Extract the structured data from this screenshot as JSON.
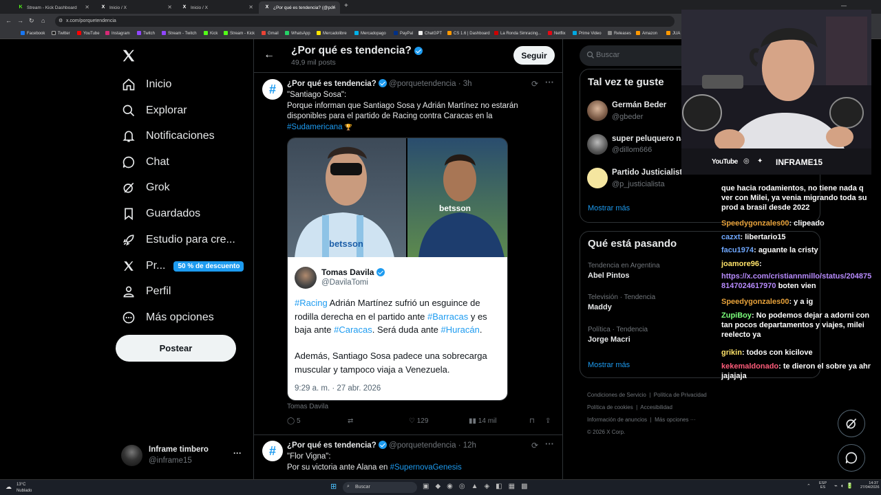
{
  "browser": {
    "tabs": [
      {
        "title": "Stream - Kick Dashboard",
        "icon": "kick-icon",
        "color": "#53fc18"
      },
      {
        "title": "Inicio / X",
        "icon": "x-logo-icon",
        "color": "#ffffff"
      },
      {
        "title": "Inicio / X",
        "icon": "x-logo-icon",
        "color": "#ffffff"
      },
      {
        "title": "¿Por qué es tendencia? (@porq...",
        "icon": "x-logo-icon",
        "color": "#ffffff"
      }
    ],
    "new_tab": "+",
    "url": "x.com/porquetendencia",
    "bookmarks": [
      "Facebook",
      "Twitter",
      "YouTube",
      "Instagram",
      "Twitch",
      "Stream - Twitch",
      "Kick",
      "Stream - Kick",
      "Gmail",
      "WhatsApp",
      "Mercadolibre",
      "Mercadopago",
      "PayPal",
      "ChatGPT",
      "CS 1.6 | Dashboard",
      "La Ronda Simracing...",
      "Netflix",
      "Prime Video",
      "Releases",
      "Amazon",
      "JUA"
    ]
  },
  "nav": {
    "items": [
      {
        "label": "Inicio",
        "icon": "home-icon"
      },
      {
        "label": "Explorar",
        "icon": "search-icon"
      },
      {
        "label": "Notificaciones",
        "icon": "bell-icon"
      },
      {
        "label": "Chat",
        "icon": "chat-icon"
      },
      {
        "label": "Grok",
        "icon": "grok-icon"
      },
      {
        "label": "Guardados",
        "icon": "bookmark-icon"
      },
      {
        "label": "Estudio para cre...",
        "icon": "rocket-icon"
      },
      {
        "label": "Pr...",
        "icon": "x-logo-icon"
      },
      {
        "label": "Perfil",
        "icon": "person-icon"
      },
      {
        "label": "Más opciones",
        "icon": "more-circle-icon"
      }
    ],
    "premium_badge": "50 % de descuento",
    "post_button": "Postear",
    "account": {
      "name": "Inframe timbero",
      "handle": "@inframe15",
      "more": "···"
    }
  },
  "header": {
    "title": "¿Por qué es tendencia?",
    "subtitle": "49,9 mil posts",
    "follow": "Seguir"
  },
  "tweet1": {
    "name": "¿Por qué es tendencia?",
    "handle": "@porquetendencia",
    "time": "· 3h",
    "line1": "\"Santiago Sosa\":",
    "body": "Porque informan que Santiago Sosa y Adrián Martínez no estarán disponibles para el partido de Racing contra Caracas en la",
    "hashtag": "#Sudamericana",
    "emoji": "🏆",
    "quote": {
      "name": "Tomas Davila",
      "handle": "@DavilaTomi",
      "tag1": "#Racing",
      "t1": " Adrián Martínez sufrió un esguince de rodilla derecha en el partido ante ",
      "tag2": "#Barracas",
      "t2": " y es baja ante ",
      "tag3": "#Caracas",
      "t3": ". Será duda ante ",
      "tag4": "#Huracán",
      "t4": ".",
      "para2": "Además, Santiago Sosa padece una sobrecarga muscular y tampoco viaja a Venezuela.",
      "timestamp": "9:29 a. m. · 27 abr. 2026"
    },
    "source": "Tomas Davila",
    "replies": "5",
    "likes": "129",
    "views": "14 mil",
    "image": {
      "jersey_text_left": "betsson",
      "jersey_text_right": "betsson"
    }
  },
  "tweet2": {
    "name": "¿Por qué es tendencia?",
    "handle": "@porquetendencia",
    "time": "· 12h",
    "line1": "\"Flor Vigna\":",
    "body": "Por su victoria ante Alana en ",
    "hashtag": "#SupernovaGenesis"
  },
  "right": {
    "search_placeholder": "Buscar",
    "suggest_title": "Tal vez te guste",
    "suggestions": [
      {
        "name": "Germán Beder",
        "handle": "@gbeder"
      },
      {
        "name": "super peluquero na",
        "handle": "@dillom666"
      },
      {
        "name": "Partido Justicialist",
        "handle": "@p_justicialista"
      }
    ],
    "follow": "Seguir",
    "show_more": "Mostrar más",
    "trends_title": "Qué está pasando",
    "trends": [
      {
        "category": "Tendencia en Argentina",
        "name": "Abel Pintos"
      },
      {
        "category": "Televisión · Tendencia",
        "name": "Maddy"
      },
      {
        "category": "Política · Tendencia",
        "name": "Jorge Macri"
      }
    ],
    "show_more2": "Mostrar más",
    "footer": [
      "Condiciones de Servicio",
      "Política de Privacidad",
      "Política de cookies",
      "Accesibilidad",
      "Información de anuncios",
      "Más opciones ···",
      "© 2026 X Corp."
    ]
  },
  "webcam": {
    "youtube": "YouTube",
    "brand": "INFRAME15"
  },
  "chat": [
    {
      "user": "",
      "msg": "que hacia rodamientos, no tiene nada q ver con Milei, ya venia migrando toda su prod a brasil desde 2022",
      "color": "#ffffff"
    },
    {
      "user": "Speedygonzales00",
      "msg": ": clipeado",
      "color": "#e8a23a"
    },
    {
      "user": "cazxt",
      "msg": ": libertario15",
      "color": "#6fa8ff"
    },
    {
      "user": "facu1974",
      "msg": ": aguante la cristy",
      "color": "#6fa8ff"
    },
    {
      "user": "joamore96",
      "msg": ":",
      "color": "#ffe36a"
    },
    {
      "user": "",
      "msg": "https://x.com/cristiannmillo/status/2048758147024617970",
      "color": "#b98cff",
      "suffix": " boten vien"
    },
    {
      "user": "Speedygonzales00",
      "msg": ": y a ig",
      "color": "#e8a23a"
    },
    {
      "user": "ZupiBoy",
      "msg": ": No podemos dejar a adorni con tan pocos departamentos y viajes, milei reelecto ya",
      "color": "#7cff7c"
    },
    {
      "user": "grikin",
      "msg": ": todos con kicilove",
      "color": "#ffe36a"
    },
    {
      "user": "kekemaldonado",
      "msg": ": te dieron el sobre ya ahr jajajaja",
      "color": "#ff5c7a"
    }
  ],
  "taskbar": {
    "weather_temp": "13°C",
    "weather_desc": "Nublado",
    "search": "Buscar",
    "lang": "ESP",
    "lang2": "ES",
    "time": "14:37",
    "date": "27/04/2026"
  }
}
